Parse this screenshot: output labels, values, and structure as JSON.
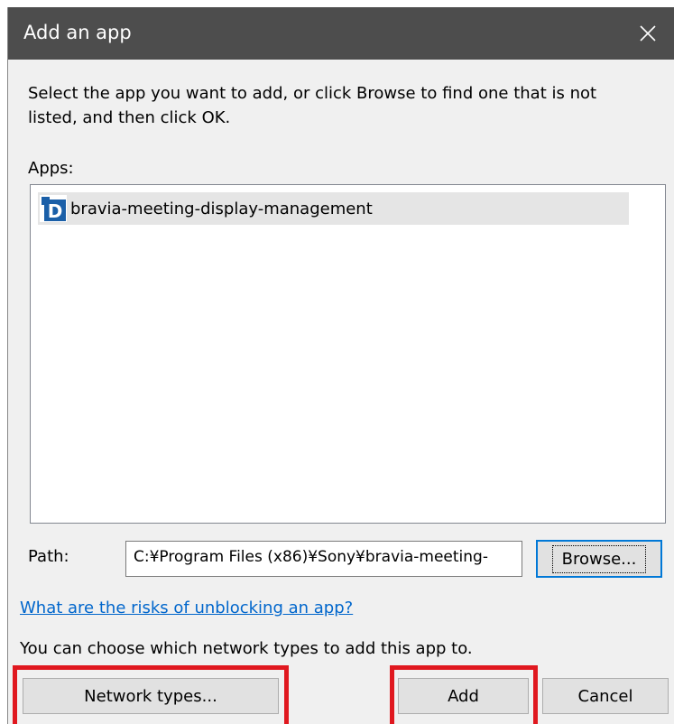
{
  "dialog": {
    "title": "Add an app",
    "instructions": "Select the app you want to add, or click Browse to find one that is not listed, and then click OK.",
    "apps_label": "Apps:",
    "apps": [
      {
        "name": "bravia-meeting-display-management",
        "icon": "app-d-icon",
        "selected": true
      }
    ],
    "path_label": "Path:",
    "path_value": "C:¥Program Files (x86)¥Sony¥bravia-meeting-",
    "browse_label": "Browse...",
    "risk_link": "What are the risks of unblocking an app?",
    "network_text": "You can choose which network types to add this app to.",
    "network_types_label": "Network types...",
    "add_label": "Add",
    "cancel_label": "Cancel"
  },
  "colors": {
    "titlebar": "#4d4d4d",
    "dialog_bg": "#f0f0f0",
    "link": "#0066cc",
    "focus_border": "#0078d7",
    "highlight": "#e0181f",
    "app_icon": "#1a5fa8"
  }
}
